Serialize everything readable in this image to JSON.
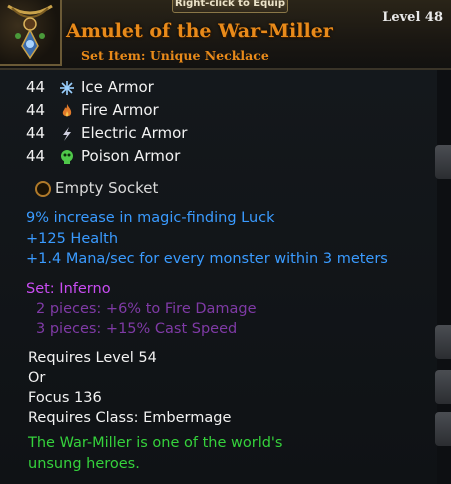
{
  "item": {
    "equip_hint": "Right-click to Equip",
    "name": "Amulet of the War-Miller",
    "subtitle": "Set Item: Unique Necklace",
    "level": "Level 48",
    "icon": "amulet-icon"
  },
  "armor": [
    {
      "value": "44",
      "label": "Ice Armor",
      "icon": "snowflake-icon",
      "color": "#9ad0ff"
    },
    {
      "value": "44",
      "label": "Fire Armor",
      "icon": "flame-icon",
      "color": "#e07a2a"
    },
    {
      "value": "44",
      "label": "Electric Armor",
      "icon": "lightning-icon",
      "color": "#d0d0e0"
    },
    {
      "value": "44",
      "label": "Poison Armor",
      "icon": "poison-skull-icon",
      "color": "#4fc84a"
    }
  ],
  "socket": {
    "label": "Empty Socket"
  },
  "stats": [
    "9% increase in magic-finding Luck",
    "+125 Health",
    "+1.4 Mana/sec for every monster within 3 meters"
  ],
  "set": {
    "title": "Set: Inferno",
    "pieces": [
      "2 pieces: +6% to Fire Damage",
      "3 pieces: +15% Cast Speed"
    ]
  },
  "requirements": [
    "Requires Level 54",
    " Or",
    "Focus 136",
    "Requires Class: Embermage"
  ],
  "flavor": [
    "The War-Miller is one of the world's",
    "unsung heroes."
  ],
  "colors": {
    "title": "#e88a1a",
    "magic_stat": "#3a9bff",
    "set_title": "#c94cf2",
    "set_piece": "#7f3aa6",
    "flavor": "#35d23c"
  }
}
